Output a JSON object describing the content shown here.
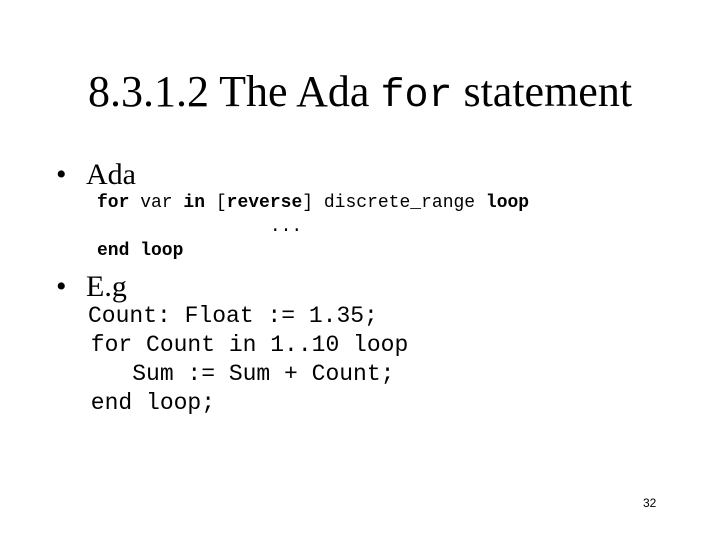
{
  "slide": {
    "title_prefix": "8.3.1.2 The Ada ",
    "title_code": "for",
    "title_suffix": " statement",
    "bullets": [
      {
        "marker": "•",
        "label": "Ada",
        "syntax": {
          "line1": [
            {
              "text": "for",
              "bold": true
            },
            {
              "text": " var ",
              "bold": false
            },
            {
              "text": "in",
              "bold": true
            },
            {
              "text": " [",
              "bold": false
            },
            {
              "text": "reverse",
              "bold": true
            },
            {
              "text": "] discrete_range ",
              "bold": false
            },
            {
              "text": "loop",
              "bold": true
            }
          ],
          "line2": "                ...",
          "line3": "end loop"
        }
      },
      {
        "marker": "•",
        "label": "E.g",
        "example_lines": [
          "Count: Float := 1.35;",
          " for Count in 1..10 loop",
          "    Sum := Sum + Count;",
          " end loop;"
        ]
      }
    ],
    "page_number": "32"
  }
}
